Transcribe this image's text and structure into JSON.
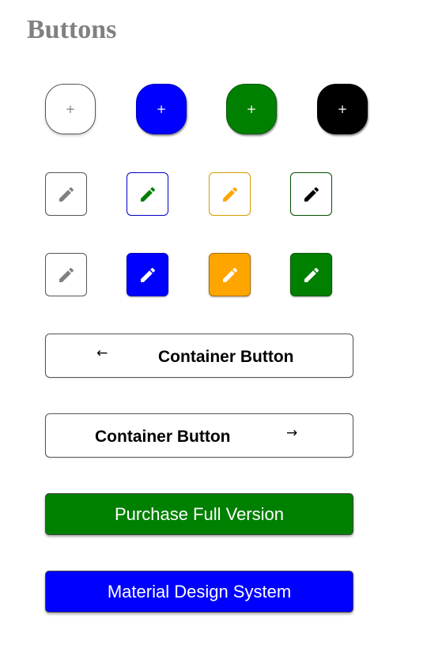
{
  "heading": "Buttons",
  "round_buttons": [
    {
      "glyph": "+",
      "style": "outline",
      "icon": "plus-icon",
      "color": "#ffffff"
    },
    {
      "glyph": "+",
      "style": "filled",
      "icon": "plus-icon",
      "color": "#0000ff"
    },
    {
      "glyph": "+",
      "style": "filled",
      "icon": "plus-icon",
      "color": "#008000"
    },
    {
      "glyph": "+",
      "style": "filled",
      "icon": "plus-icon",
      "color": "#000000"
    }
  ],
  "outlined_edit_buttons": [
    {
      "icon": "pencil-icon",
      "icon_color": "#808080",
      "border_color": "#555555"
    },
    {
      "icon": "pencil-icon",
      "icon_color": "#008000",
      "border_color": "#0000c8"
    },
    {
      "icon": "pencil-icon",
      "icon_color": "#ffa500",
      "border_color": "#d89a00"
    },
    {
      "icon": "pencil-icon",
      "icon_color": "#000000",
      "border_color": "#004d00"
    }
  ],
  "filled_edit_buttons": [
    {
      "icon": "pencil-icon",
      "icon_color": "#808080",
      "fill": "#ffffff"
    },
    {
      "icon": "pencil-icon",
      "icon_color": "#ffffff",
      "fill": "#0000ff"
    },
    {
      "icon": "pencil-icon",
      "icon_color": "#ffffff",
      "fill": "#ffa500"
    },
    {
      "icon": "pencil-icon",
      "icon_color": "#ffffff",
      "fill": "#008000"
    }
  ],
  "container_buttons": [
    {
      "label": "Container Button",
      "arrow": "←",
      "icon": "arrow-left-icon"
    },
    {
      "label": "Container Button",
      "arrow": "→",
      "icon": "arrow-right-icon"
    }
  ],
  "wide_buttons": [
    {
      "label": "Purchase Full Version",
      "color": "#008000"
    },
    {
      "label": "Material Design System",
      "color": "#0000ff"
    }
  ]
}
